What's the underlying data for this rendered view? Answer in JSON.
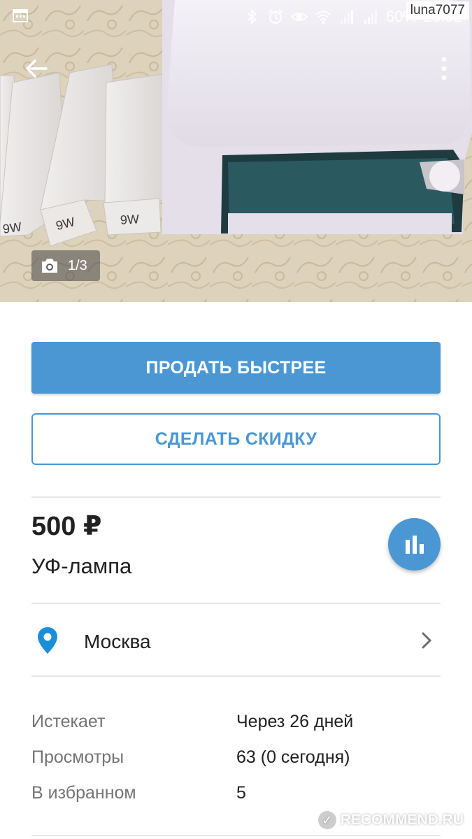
{
  "status_bar": {
    "battery": "60%",
    "time": "23:32",
    "icons": [
      "calendar-icon",
      "bluetooth-icon",
      "alarm-icon",
      "eye-icon",
      "wifi-icon",
      "signal-icon",
      "signal-icon"
    ]
  },
  "watermark_user": "luna7077",
  "photo": {
    "lamp_labels": [
      "9W",
      "9W",
      "9W"
    ],
    "counter": "1/3"
  },
  "actions": {
    "sell_faster": "ПРОДАТЬ БЫСТРЕЕ",
    "make_discount": "СДЕЛАТЬ СКИДКУ"
  },
  "listing": {
    "price": "500 ₽",
    "title": "УФ-лампа",
    "location": "Москва"
  },
  "stats": [
    {
      "label": "Истекает",
      "value": "Через 26 дней"
    },
    {
      "label": "Просмотры",
      "value": "63 (0 сегодня)"
    },
    {
      "label": "В избранном",
      "value": "5"
    }
  ],
  "watermark_site": "RECOMMEND.RU",
  "colors": {
    "accent": "#4a97d4",
    "pin": "#1a8fd8",
    "divider": "#e6e6e6",
    "label_gray": "#757575"
  }
}
